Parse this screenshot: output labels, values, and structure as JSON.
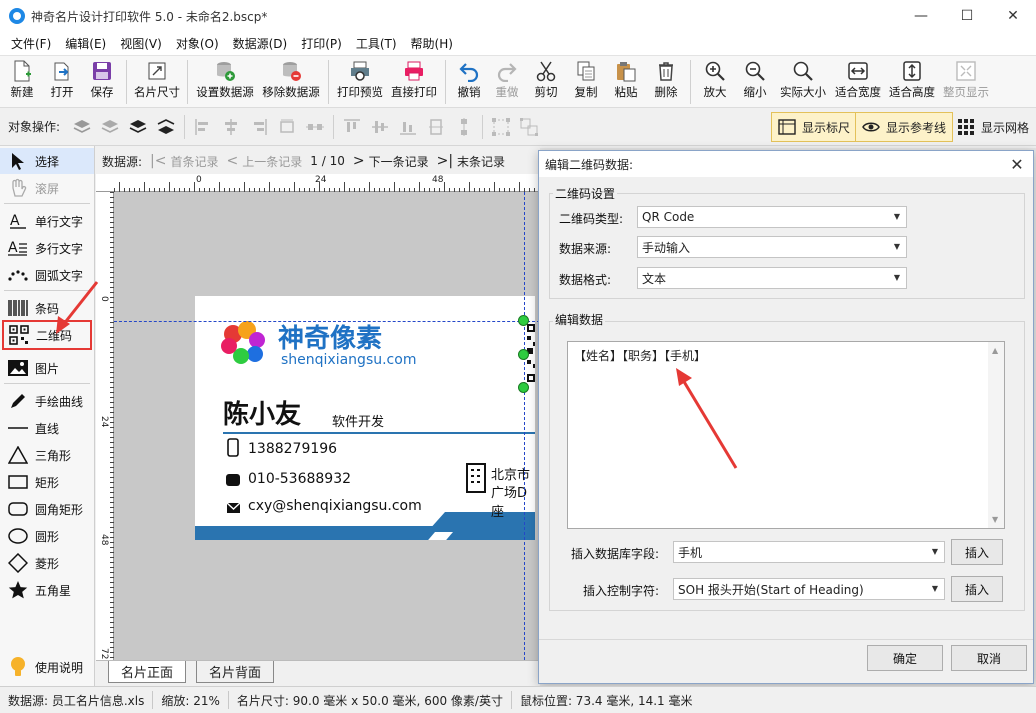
{
  "window": {
    "title": "神奇名片设计打印软件 5.0 - 未命名2.bscp*",
    "minimize": "—",
    "maximize": "☐",
    "close": "✕"
  },
  "menu": [
    "文件(F)",
    "编辑(E)",
    "视图(V)",
    "对象(O)",
    "数据源(D)",
    "打印(P)",
    "工具(T)",
    "帮助(H)"
  ],
  "toolbar": {
    "new": "新建",
    "open": "打开",
    "save": "保存",
    "card_size": "名片尺寸",
    "set_datasource": "设置数据源",
    "remove_datasource": "移除数据源",
    "print_preview": "打印预览",
    "direct_print": "直接打印",
    "undo": "撤销",
    "redo": "重做",
    "cut": "剪切",
    "copy": "复制",
    "paste": "粘贴",
    "delete": "删除",
    "zoom_in": "放大",
    "zoom_out": "缩小",
    "actual_size": "实际大小",
    "fit_width": "适合宽度",
    "fit_height": "适合高度",
    "full_page": "整页显示"
  },
  "ops": {
    "label": "对象操作:",
    "show_ruler": "显示标尺",
    "show_guides": "显示参考线",
    "show_grid": "显示网格"
  },
  "tools": {
    "select": "选择",
    "pan": "滚屏",
    "single_text": "单行文字",
    "multi_text": "多行文字",
    "arc_text": "圆弧文字",
    "barcode": "条码",
    "qrcode": "二维码",
    "image": "图片",
    "freehand": "手绘曲线",
    "line": "直线",
    "triangle": "三角形",
    "rect": "矩形",
    "round_rect": "圆角矩形",
    "ellipse": "圆形",
    "diamond": "菱形",
    "star": "五角星",
    "help": "使用说明"
  },
  "nav": {
    "label": "数据源:",
    "first": "首条记录",
    "prev": "上一条记录",
    "counter": "1 / 10",
    "next": "下一条记录",
    "last": "末条记录"
  },
  "ruler": {
    "top": [
      "0",
      "24",
      "48"
    ],
    "left": [
      "0",
      "24",
      "48",
      "72"
    ]
  },
  "card": {
    "brand_cn": "神奇像素",
    "brand_url": "shenqixiangsu.com",
    "name": "陈小友",
    "job": "软件开发",
    "phone": "1388279196",
    "tel": "010-53688932",
    "email": "cxy@shenqixiangsu.com",
    "addr1": "北京市",
    "addr2": "广场D座"
  },
  "tabs": [
    "名片正面",
    "名片背面"
  ],
  "status": {
    "datasource": "数据源: 员工名片信息.xls",
    "zoom": "缩放: 21%",
    "size": "名片尺寸: 90.0 毫米 x 50.0 毫米, 600 像素/英寸",
    "mouse": "鼠标位置: 73.4 毫米, 14.1 毫米"
  },
  "dialog": {
    "title": "编辑二维码数据:",
    "group1": "二维码设置",
    "type_label": "二维码类型:",
    "type_value": "QR Code",
    "source_label": "数据来源:",
    "source_value": "手动输入",
    "format_label": "数据格式:",
    "format_value": "文本",
    "group2": "编辑数据",
    "data_text": "【姓名】【职务】【手机】",
    "db_field_label": "插入数据库字段:",
    "db_field_value": "手机",
    "ctrl_char_label": "插入控制字符:",
    "ctrl_char_value": "SOH  报头开始(Start of Heading)",
    "insert1": "插入",
    "insert2": "插入",
    "ok": "确定",
    "cancel": "取消"
  },
  "colors": {
    "accent_blue": "#1f72c4",
    "card_band": "#2a74b0",
    "highlight_red": "#e53935",
    "handle_green": "#2ecc40"
  }
}
